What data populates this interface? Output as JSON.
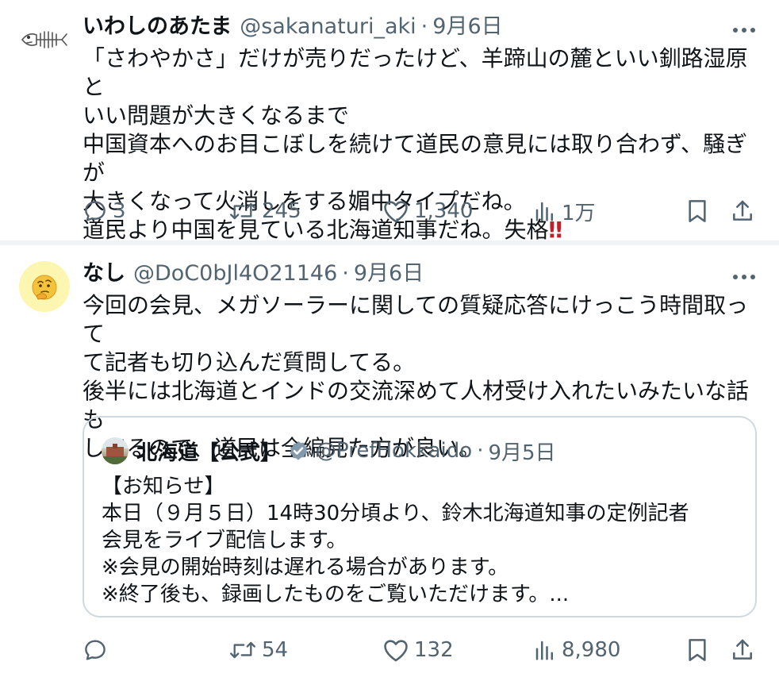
{
  "tweets": [
    {
      "author_name": "いわしのあたま",
      "handle": "@sakanaturi_aki",
      "separator": "·",
      "date": "9月6日",
      "avatar_icon": "fish-bone-icon",
      "text_lines": [
        "「さわやかさ」だけが売りだったけど、羊蹄山の麓といい釧路湿原と",
        "いい問題が大きくなるまで",
        "中国資本へのお目こぼしを続けて道民の意見には取り合わず、騒ぎが",
        "大きくなって火消しをする媚中タイプだね。",
        "道民より中国を見ている北海道知事だね。失格"
      ],
      "emoji": "‼",
      "metrics": {
        "replies": "3",
        "reposts": "245",
        "likes": "1,340",
        "views": "1万"
      }
    },
    {
      "author_name": "なし",
      "handle": "@DoC0bJl4O21146",
      "separator": "·",
      "date": "9月6日",
      "avatar_icon": "thinking-face-icon",
      "text_lines": [
        "今回の会見、メガソーラーに関しての質疑応答にけっこう時間取って",
        "て記者も切り込んだ質問してる。",
        "後半には北海道とインドの交流深めて人材受け入れたいみたいな話も",
        "してるので、道民は全編見た方が良い。"
      ],
      "quote": {
        "author_name": "北海道【公式】",
        "handle": "@PrefHokkaido",
        "separator": "·",
        "date": "9月5日",
        "verified_icon": "verified-badge-icon",
        "text_lines": [
          "【お知らせ】",
          "本日（９月５日）14時30分頃より、鈴木北海道知事の定例記者",
          "会見をライブ配信します。",
          "※会見の開始時刻は遅れる場合があります。",
          "※終了後も、録画したものをご覧いただけます。..."
        ]
      },
      "metrics": {
        "replies": "",
        "reposts": "54",
        "likes": "132",
        "views": "8,980"
      }
    }
  ],
  "colors": {
    "text": "#0f1419",
    "secondary": "#536471",
    "border": "#cfd9de",
    "separator": "#eff3f4",
    "alarm": "#c01f2e"
  }
}
